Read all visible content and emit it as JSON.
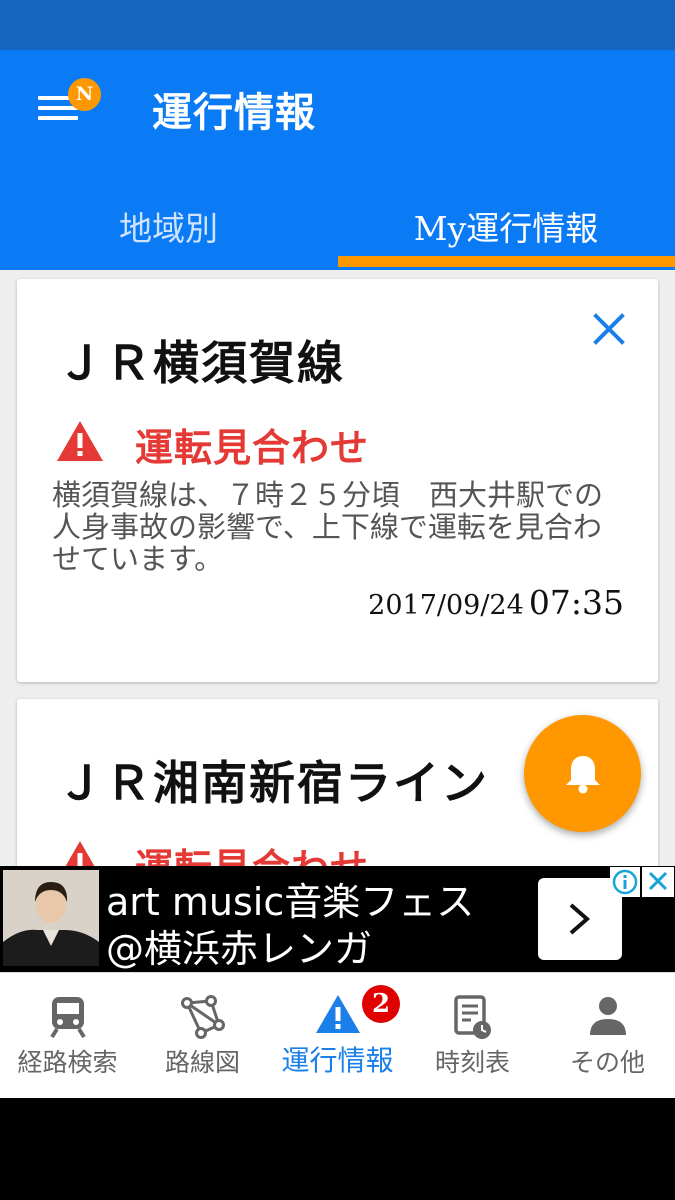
{
  "header": {
    "menu_badge": "N",
    "title": "運行情報"
  },
  "tabs": [
    {
      "label": "地域別",
      "active": false
    },
    {
      "label": "My運行情報",
      "active": true
    }
  ],
  "cards": [
    {
      "line_name": "ＪＲ横須賀線",
      "status": "運転見合わせ",
      "detail": "横須賀線は、７時２５分頃　西大井駅での人身事故の影響で、上下線で運転を見合わせています。",
      "date": "2017/09/24",
      "time": "07:35"
    },
    {
      "line_name": "ＪＲ湘南新宿ライン",
      "status": "運転見合わせ"
    }
  ],
  "ad": {
    "line1": "art music音楽フェス",
    "line2": "@横浜赤レンガ"
  },
  "bottom_nav": {
    "items": [
      {
        "label": "経路検索",
        "icon": "train-icon"
      },
      {
        "label": "路線図",
        "icon": "route-map-icon"
      },
      {
        "label": "運行情報",
        "icon": "warning-icon",
        "active": true
      },
      {
        "label": "時刻表",
        "icon": "timetable-icon"
      },
      {
        "label": "その他",
        "icon": "person-icon"
      }
    ],
    "badge_count": "2"
  },
  "colors": {
    "status_bar": "#1565c0",
    "header": "#0a7bf5",
    "accent_orange": "#ff9800",
    "alert_red": "#e53935",
    "nav_active": "#1a7fe8"
  }
}
